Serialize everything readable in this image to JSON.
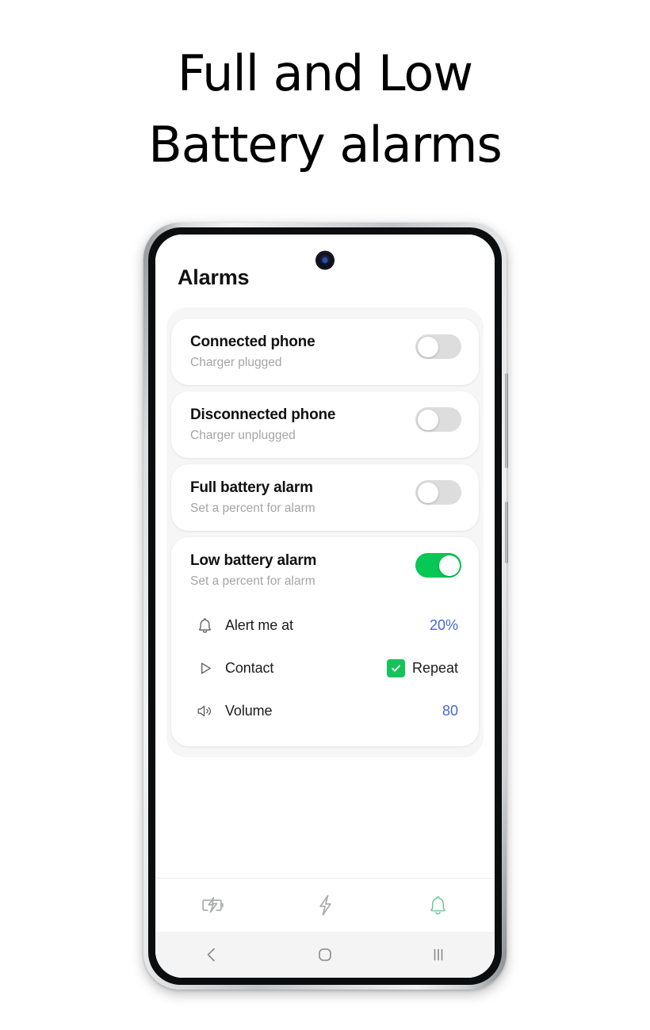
{
  "headline": {
    "line1": "Full and Low",
    "line2": "Battery alarms"
  },
  "app": {
    "title": "Alarms",
    "cards": [
      {
        "title": "Connected phone",
        "subtitle": "Charger plugged",
        "toggle": "off"
      },
      {
        "title": "Disconnected phone",
        "subtitle": "Charger unplugged",
        "toggle": "off"
      },
      {
        "title": "Full battery alarm",
        "subtitle": "Set a percent for alarm",
        "toggle": "off"
      },
      {
        "title": "Low battery alarm",
        "subtitle": "Set a percent for alarm",
        "toggle": "on",
        "rows": [
          {
            "icon": "bell-icon",
            "label": "Alert me at",
            "value": "20%"
          },
          {
            "icon": "play-icon",
            "label": "Contact",
            "checkbox_label": "Repeat",
            "checked": true
          },
          {
            "icon": "volume-icon",
            "label": "Volume",
            "value": "80"
          }
        ]
      }
    ],
    "tabs": [
      {
        "icon": "battery-charging-icon",
        "active": false
      },
      {
        "icon": "lightning-bolt-icon",
        "active": false
      },
      {
        "icon": "bell-icon",
        "active": true
      }
    ]
  },
  "navbar": {
    "back": "back-icon",
    "home": "home-icon",
    "recents": "recents-icon"
  },
  "colors": {
    "toggle_on": "#07c755",
    "checkbox": "#14c45a",
    "value_blue": "#4866d4",
    "tab_active": "#74c6a2"
  }
}
